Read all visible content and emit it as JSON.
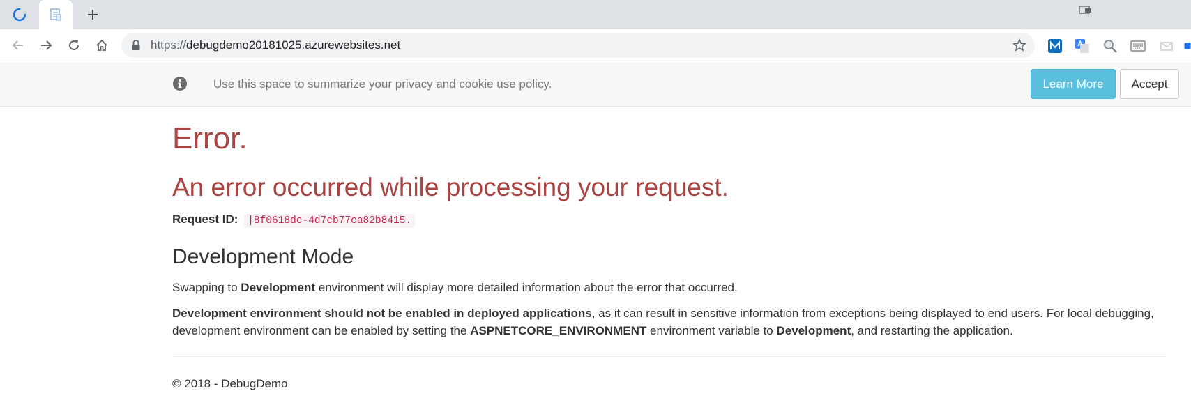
{
  "browser": {
    "url_scheme": "https://",
    "url_host": "debugdemo20181025.azurewebsites.net"
  },
  "cookie_banner": {
    "message": "Use this space to summarize your privacy and cookie use policy.",
    "learn_more_label": "Learn More",
    "accept_label": "Accept"
  },
  "error": {
    "title": "Error.",
    "subtitle": "An error occurred while processing your request.",
    "request_id_label": "Request ID:",
    "request_id_value": "|8f0618dc-4d7cb77ca82b8415."
  },
  "development": {
    "heading": "Development Mode",
    "p1_before": "Swapping to ",
    "p1_bold": "Development",
    "p1_after": " environment will display more detailed information about the error that occurred.",
    "p2_bold1": "Development environment should not be enabled in deployed applications",
    "p2_text1": ", as it can result in sensitive information from exceptions being displayed to end users. For local debugging, development environment can be enabled by setting the ",
    "p2_bold2": "ASPNETCORE_ENVIRONMENT",
    "p2_text2": " environment variable to ",
    "p2_bold3": "Development",
    "p2_text3": ", and restarting the application."
  },
  "footer": {
    "text": "© 2018 - DebugDemo"
  },
  "colors": {
    "error_red": "#a94442",
    "info_button": "#5bc0de",
    "code_pink": "#c7254e"
  },
  "icons": {
    "tab_loading": "loading-spinner-icon",
    "tab_favicon": "page-favicon-icon",
    "lock": "lock-icon",
    "info": "info-circle-icon"
  }
}
